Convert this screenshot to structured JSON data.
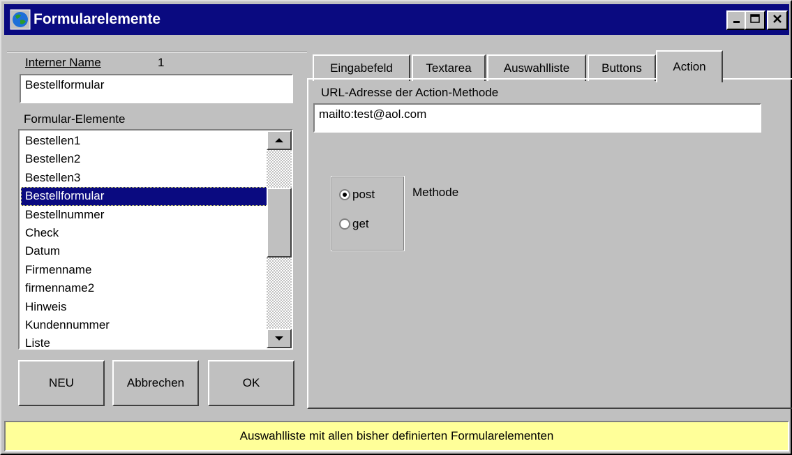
{
  "window": {
    "title": "Formularelemente",
    "titlebar_color": "#0a0a80"
  },
  "left": {
    "internal_name_label": "Interner Name",
    "internal_name_number": "1",
    "internal_name_value": "Bestellformular",
    "elements_label": "Formular-Elemente",
    "elements": [
      "Bestellen1",
      "Bestellen2",
      "Bestellen3",
      "Bestellformular",
      "Bestellnummer",
      "Check",
      "Datum",
      "Firmenname",
      "firmenname2",
      "Hinweis",
      "Kundennummer",
      "Liste"
    ],
    "selected_element": "Bestellformular",
    "buttons": {
      "new": "NEU",
      "cancel": "Abbrechen",
      "ok": "OK"
    }
  },
  "tabs": [
    {
      "label": "Eingabefeld",
      "active": false
    },
    {
      "label": "Textarea",
      "active": false
    },
    {
      "label": "Auswahlliste",
      "active": false
    },
    {
      "label": "Buttons",
      "active": false
    },
    {
      "label": "Action",
      "active": true
    }
  ],
  "action": {
    "url_label": "URL-Adresse der Action-Methode",
    "url_value": "mailto:test@aol.com",
    "method_label": "Methode",
    "methods": [
      {
        "label": "post",
        "checked": true
      },
      {
        "label": "get",
        "checked": false
      }
    ]
  },
  "status": {
    "text": "Auswahlliste mit allen bisher definierten Formularelementen",
    "background": "#ffff99"
  }
}
